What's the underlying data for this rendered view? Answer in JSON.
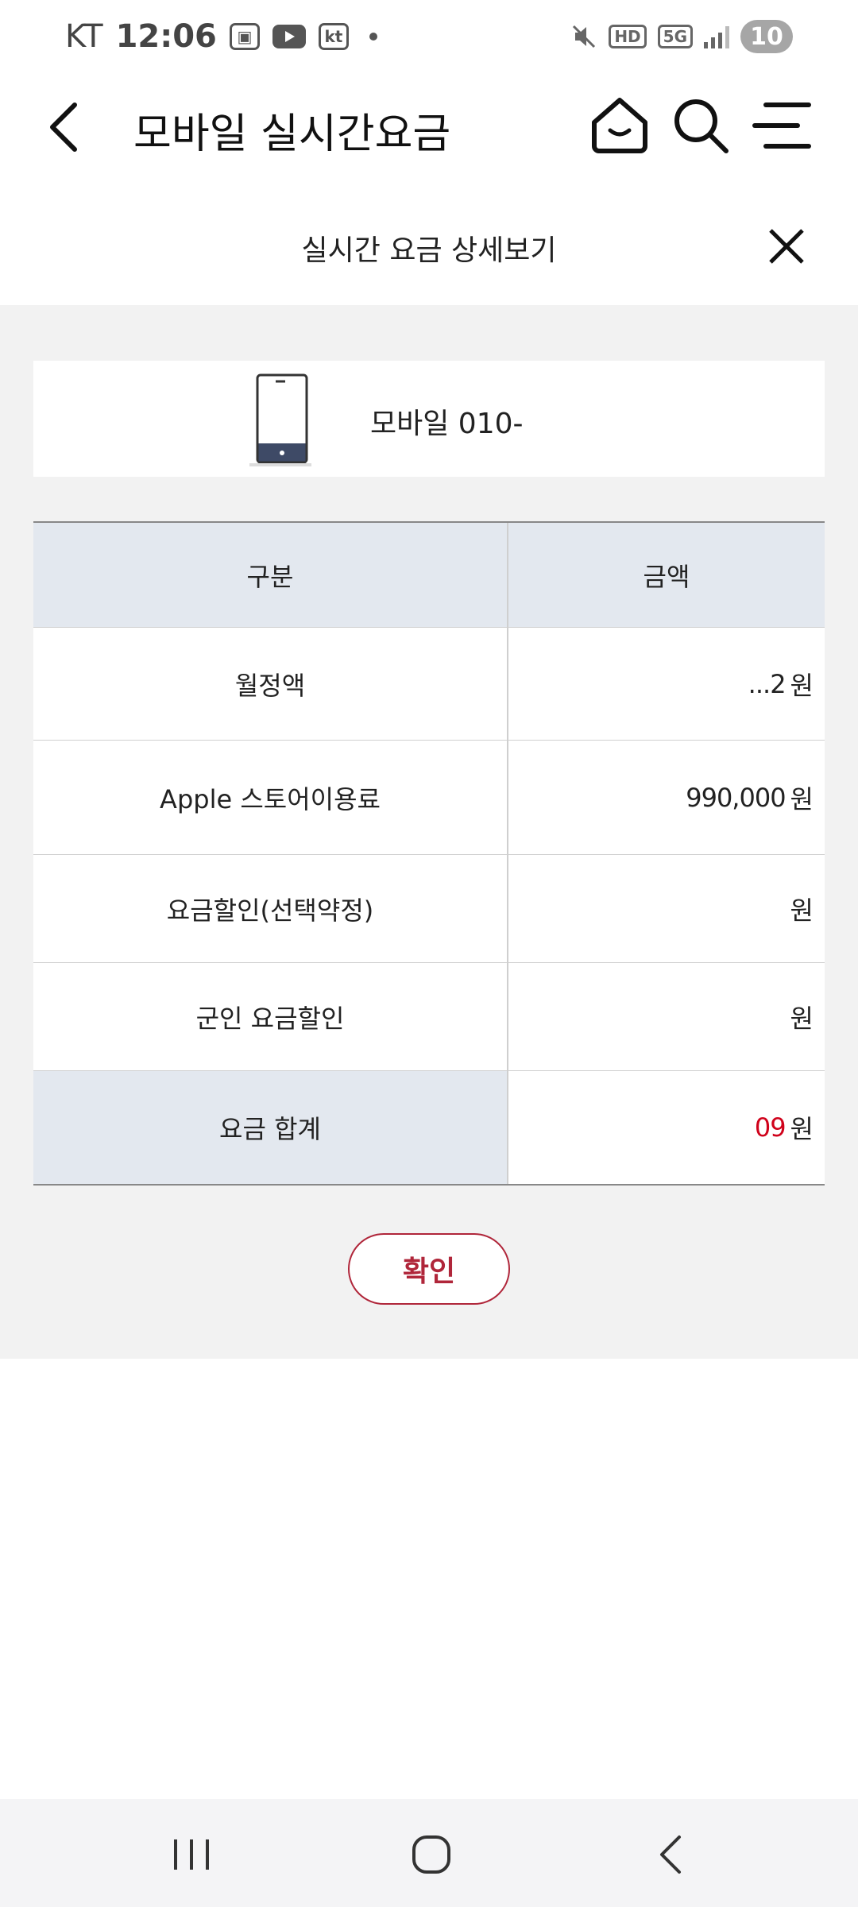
{
  "status_bar": {
    "carrier": "KT",
    "time": "12:06",
    "kt_badge": "kt",
    "hd_label": "HD",
    "network_label": "5G",
    "battery": "10"
  },
  "header": {
    "title": "모바일 실시간요금",
    "icons": [
      "back-icon",
      "home-icon",
      "search-icon",
      "menu-icon"
    ]
  },
  "sheet": {
    "title": "실시간 요금 상세보기"
  },
  "device": {
    "label": "모바일 010-"
  },
  "table": {
    "headers": {
      "category": "구분",
      "amount": "금액"
    },
    "rows": [
      {
        "label": "월정액",
        "amount": "...2",
        "unit": "원"
      },
      {
        "label": "Apple 스토어이용료",
        "amount": "990,000",
        "unit": "원"
      },
      {
        "label": "요금할인(선택약정)",
        "amount": "",
        "unit": "원"
      },
      {
        "label": "군인 요금할인",
        "amount": "",
        "unit": "원"
      }
    ],
    "total": {
      "label": "요금 합계",
      "amount": "09",
      "unit": "원"
    }
  },
  "confirm_label": "확인",
  "colors": {
    "accent": "#b0263a",
    "total_amount": "#d0021b",
    "table_header_bg": "#e3e8ef",
    "panel_bg": "#f2f2f2"
  }
}
